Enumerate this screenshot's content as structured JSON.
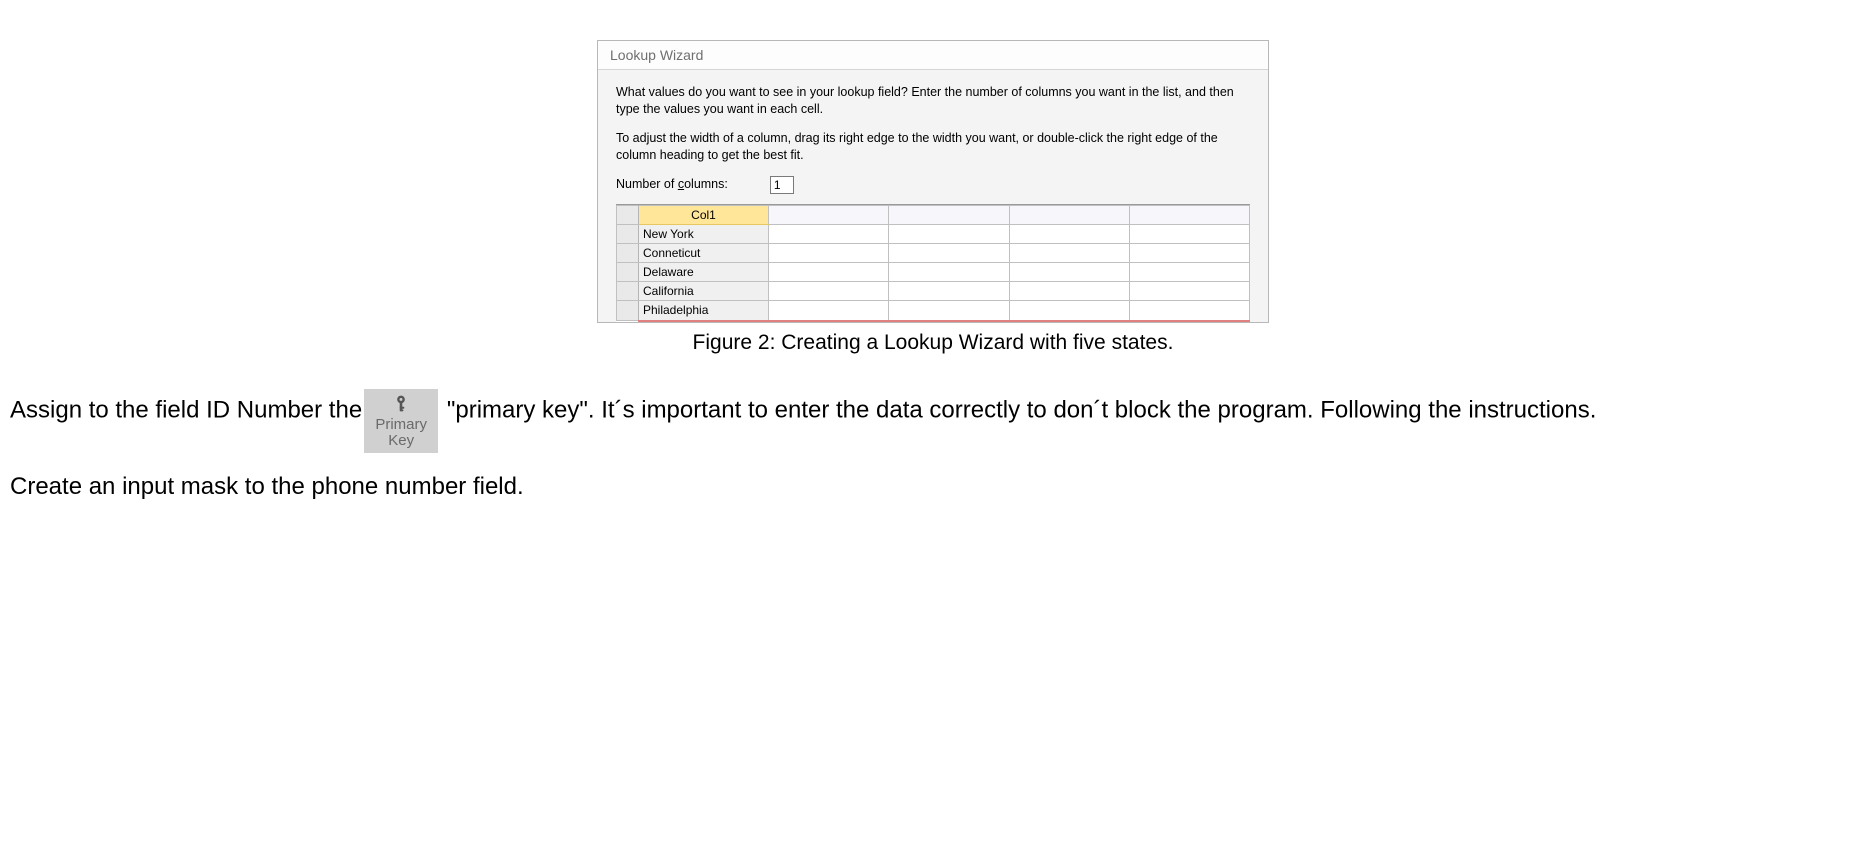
{
  "dialog": {
    "title": "Lookup Wizard",
    "intro1": "What values do you want to see in your lookup field? Enter the number of columns you want in the list, and then type the values you want in each cell.",
    "intro2": "To adjust the width of a column, drag its right edge to the width you want, or double-click the right edge of the column heading to get the best fit.",
    "numcols_label_pre": "Number of ",
    "numcols_label_u": "c",
    "numcols_label_post": "olumns:",
    "numcols_value": "1",
    "grid": {
      "col_header": "Col1",
      "rows": [
        "New York",
        "Conneticut",
        "Delaware",
        "California",
        "Philadelphia"
      ]
    }
  },
  "caption": "Figure 2:  Creating a Lookup Wizard with five states.",
  "paragraph1": {
    "before": "Assign to the field ID Number the",
    "after": " \"primary key\".  It´s important to enter the data correctly to don´t block the program.  Following the instructions."
  },
  "pk_button": {
    "line1": "Primary",
    "line2": "Key"
  },
  "paragraph2": "Create an input mask to the phone number field."
}
